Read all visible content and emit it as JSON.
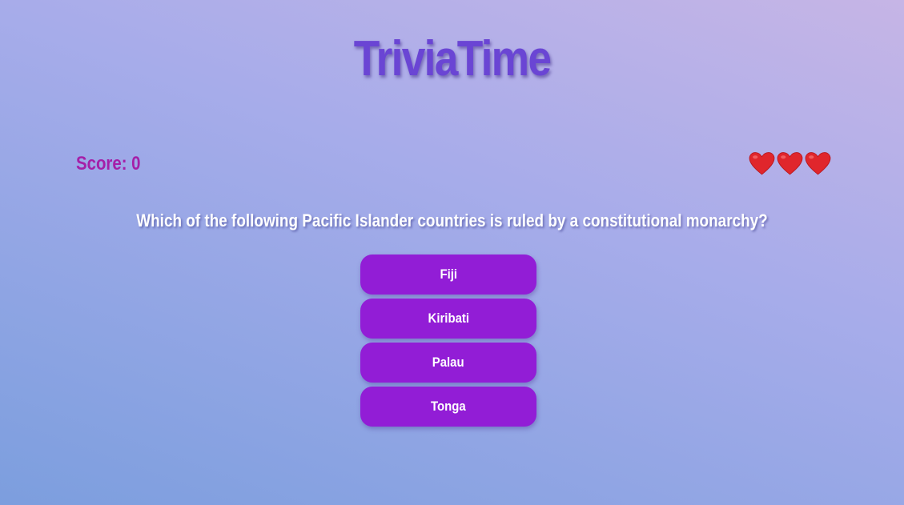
{
  "app": {
    "title": "TriviaTime"
  },
  "status": {
    "score_label": "Score: 0",
    "lives": 3,
    "heart_icon": "heart-icon",
    "heart_color": "#e0262c"
  },
  "question": {
    "text": "Which of the following Pacific Islander countries is ruled by a constitutional monarchy?"
  },
  "answers": [
    {
      "label": "Fiji"
    },
    {
      "label": "Kiribati"
    },
    {
      "label": "Palau"
    },
    {
      "label": "Tonga"
    }
  ],
  "colors": {
    "title": "#6a45d4",
    "score": "#a51fa8",
    "button": "#921dd6",
    "button_text": "#ffffff"
  }
}
